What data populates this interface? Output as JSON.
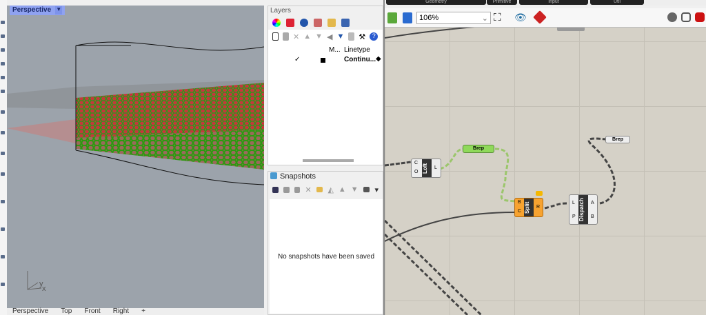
{
  "viewport": {
    "title": "Perspective",
    "tabs": [
      "Perspective",
      "Top",
      "Front",
      "Right"
    ],
    "axis_x": "x",
    "axis_y": "y"
  },
  "layers": {
    "title": "Layers",
    "columns": [
      "M...",
      "Linetype"
    ],
    "rows": [
      {
        "check": "✓",
        "linetype": "Continu..."
      }
    ]
  },
  "snapshots": {
    "title": "Snapshots",
    "empty": "No snapshots have been saved"
  },
  "grasshopper": {
    "tabs": [
      "Geometry",
      "Primitive",
      "Input",
      "Util"
    ],
    "zoom": "106%",
    "components": {
      "loft": {
        "name": "Loft",
        "inputs": [
          "C",
          "O"
        ],
        "outputs": [
          "L"
        ]
      },
      "brep1": {
        "name": "Brep"
      },
      "brep2": {
        "name": "Brep"
      },
      "split": {
        "name": "Split",
        "inputs": [
          "B",
          "C"
        ],
        "outputs": [
          "R"
        ]
      },
      "dispatch": {
        "name": "Dispatch",
        "inputs": [
          "L",
          "P"
        ],
        "outputs": [
          "A",
          "B"
        ]
      }
    }
  }
}
